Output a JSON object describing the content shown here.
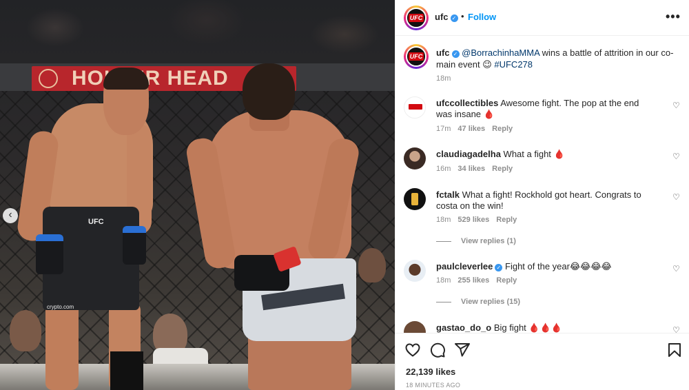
{
  "media": {
    "banner_text": "HOLLER HEAD",
    "shorts_brand": "UFC",
    "shorts_sponsor": "crypto.com"
  },
  "post_header": {
    "username": "ufc",
    "separator": "•",
    "follow_label": "Follow",
    "more_label": "•••",
    "avatar_text": "UFC"
  },
  "caption": {
    "username": "ufc",
    "mention": "@BorrachinhaMMA",
    "text": " wins a battle of attrition in our co-main event 😉 ",
    "hashtag": "#UFC278",
    "time": "18m"
  },
  "comments": [
    {
      "username": "ufccollectibles",
      "text": "Awesome fight. The pop at the end was insane 🩸",
      "time": "17m",
      "likes": "47 likes",
      "reply_label": "Reply"
    },
    {
      "username": "claudiagadelha",
      "text": "What a fight 🩸",
      "time": "16m",
      "likes": "34 likes",
      "reply_label": "Reply"
    },
    {
      "username": "fctalk",
      "text": "What a fight! Rockhold got heart. Congrats to costa on the win!",
      "time": "18m",
      "likes": "529 likes",
      "reply_label": "Reply",
      "view_replies": "View replies (1)"
    },
    {
      "username": "paulcleverlee",
      "text": "Fight of the year😂😂😂😂",
      "time": "18m",
      "likes": "255 likes",
      "reply_label": "Reply",
      "view_replies": "View replies (15)"
    },
    {
      "username": "gastao_do_o",
      "text": "Big fight 🩸🩸🩸"
    }
  ],
  "actions": {
    "likes": "22,139 likes",
    "time_ago": "18 MINUTES AGO",
    "icons": [
      "heart-icon",
      "comment-icon",
      "share-icon",
      "bookmark-icon"
    ]
  },
  "colors": {
    "link_blue": "#0095f6",
    "verified_blue": "#3897f0",
    "muted_text": "#8e8e8e",
    "ufc_red": "#d20a11"
  }
}
